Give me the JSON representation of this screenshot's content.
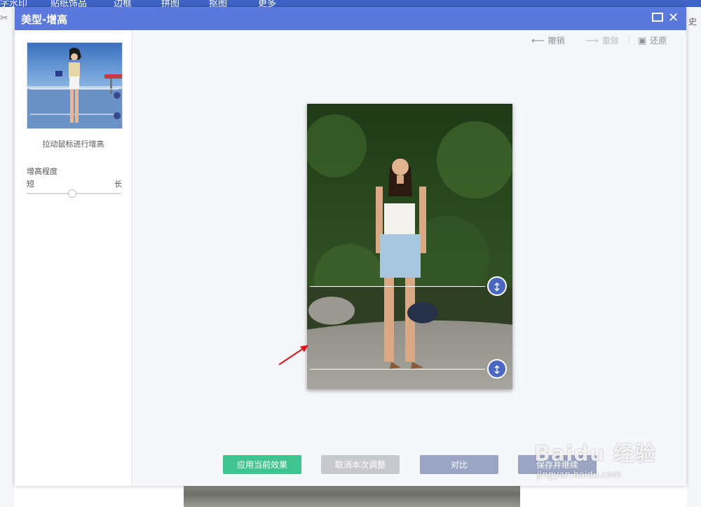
{
  "background": {
    "menu_items": [
      "字水印",
      "贴纸饰品",
      "边框",
      "拼图",
      "抠图",
      "更多"
    ],
    "right_edge_text": "史"
  },
  "dialog": {
    "title": "美型-增高",
    "maximize_icon": "maximize-icon",
    "close_icon": "close-icon"
  },
  "left_panel": {
    "hint": "拉动鼠标进行增高",
    "degree_label": "增高程度",
    "slider_min_label": "短",
    "slider_max_label": "长",
    "slider_value": 0.48
  },
  "toolbar": {
    "undo_label": "撤销",
    "redo_label": "重做",
    "restore_label": "还原"
  },
  "canvas": {
    "handle_icon": "vertical-resize-icon"
  },
  "actions": {
    "apply_label": "应用当前效果",
    "cancel_label": "取消本次调整",
    "compare_label": "对比",
    "save_label": "保存并继续"
  },
  "watermark": {
    "brand": "Baidu 经验",
    "url": "jingyan.baidu.com"
  },
  "colors": {
    "header": "#5a78de",
    "apply_button": "#3fc48f",
    "cancel_button": "#c7c9ce",
    "secondary_button": "#9aa5c4",
    "handle": "#4b67c4"
  }
}
